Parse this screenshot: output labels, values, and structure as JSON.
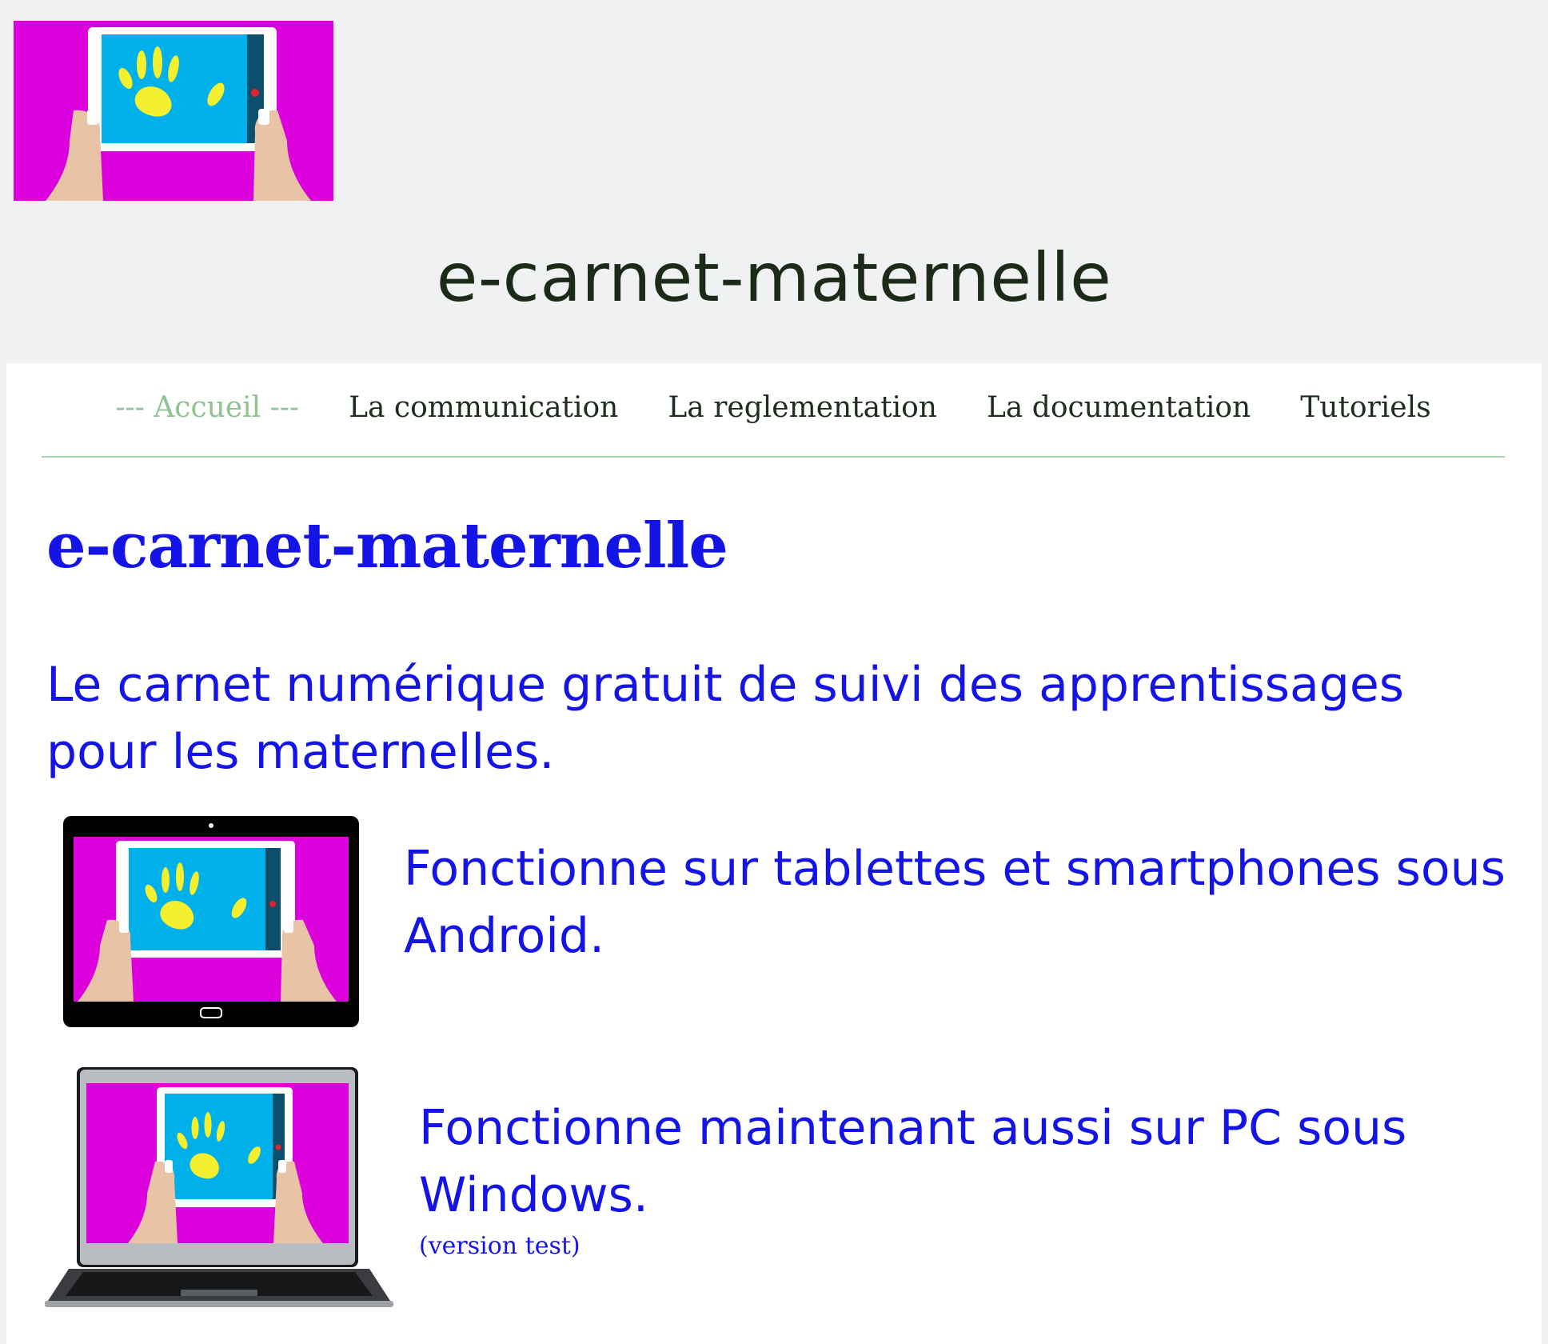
{
  "header": {
    "site_title": "e-carnet-maternelle"
  },
  "nav": {
    "items": [
      {
        "label": "--- Accueil ---",
        "active": true
      },
      {
        "label": "La communication",
        "active": false
      },
      {
        "label": "La reglementation",
        "active": false
      },
      {
        "label": "La documentation",
        "active": false
      },
      {
        "label": "Tutoriels",
        "active": false
      }
    ]
  },
  "main": {
    "title": "e-carnet-maternelle",
    "tagline": "Le carnet numérique gratuit de suivi des apprentissages pour les maternelles.",
    "features": [
      {
        "text": "Fonctionne sur tablettes et smartphones sous Android.",
        "icon": "android-tablet-icon"
      },
      {
        "text": "Fonctionne maintenant aussi sur PC sous Windows.",
        "note": "(version test)",
        "icon": "windows-laptop-icon"
      }
    ]
  },
  "colors": {
    "magenta": "#dc00dc",
    "screen_blue": "#00b0ea",
    "hand_yellow": "#f4f030",
    "link_blue": "#1414e6",
    "active_green": "#8fc394",
    "header_bg": "#f0f1f3"
  }
}
